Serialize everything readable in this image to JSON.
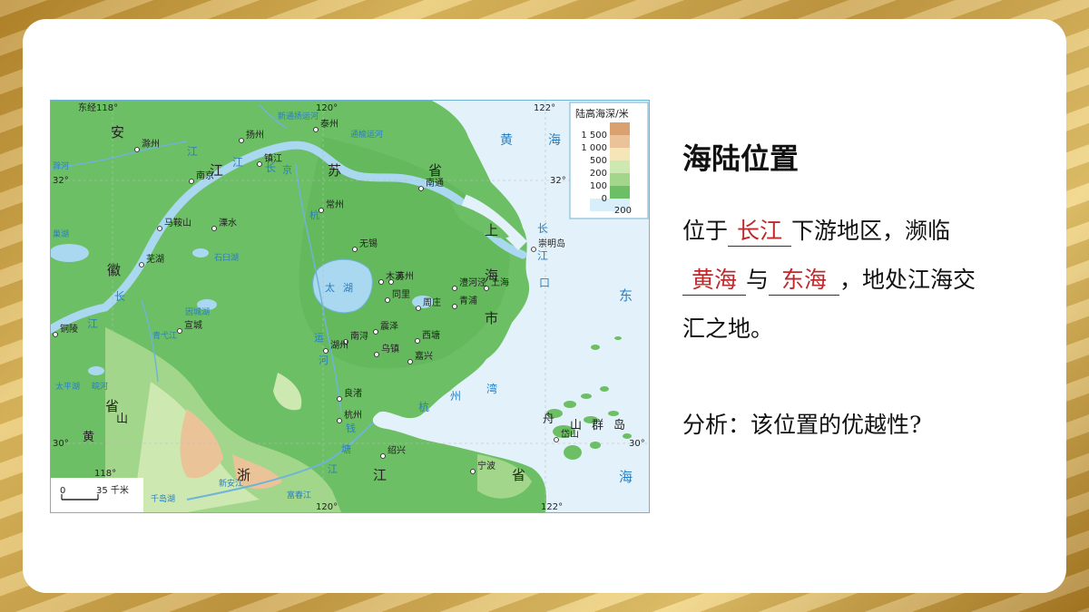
{
  "map": {
    "legend_title": "陆高海深/米",
    "legend_values": [
      "1 500",
      "1 000",
      "500",
      "200",
      "100",
      "0",
      "200"
    ],
    "legend_colors": [
      "#d9a070",
      "#ebc398",
      "#f5e6b8",
      "#cde8b0",
      "#a2d68a",
      "#6cbf64",
      "#d8eefa"
    ],
    "scale": {
      "zero": "0",
      "label": "35 千米"
    },
    "coords": [
      "东经118°",
      "120°",
      "122°",
      "32°",
      "32°",
      "30°",
      "30°",
      "118°",
      "120°",
      "122°"
    ],
    "cities": [
      "扬州",
      "泰州",
      "滁州",
      "南京",
      "镇江",
      "南通",
      "常州",
      "马鞍山",
      "溧水",
      "无锡",
      "崇明岛",
      "芜湖",
      "木渎",
      "苏州",
      "澧河泾",
      "上海",
      "同里",
      "周庄",
      "青浦",
      "震泽",
      "铜陵",
      "宣城",
      "南浔",
      "西塘",
      "湖州",
      "乌镇",
      "嘉兴",
      "良渚",
      "杭州",
      "绍兴",
      "宁波",
      "岱山"
    ],
    "regions": [
      "安",
      "江",
      "苏",
      "省",
      "徽",
      "上",
      "海",
      "市",
      "浙",
      "江",
      "省",
      "黄",
      "山",
      "舟",
      "山",
      "群",
      "岛",
      "省"
    ],
    "waters": [
      "黄",
      "海",
      "东",
      "海",
      "长",
      "江",
      "口",
      "太",
      "湖",
      "杭",
      "州",
      "湾",
      "新通扬运河",
      "通榆运河",
      "江",
      "京",
      "杭",
      "运",
      "河",
      "滁河",
      "皖河",
      "巢湖",
      "固城湖",
      "石臼湖",
      "长",
      "江",
      "青弋江",
      "新安江",
      "富春江",
      "千岛湖",
      "太平湖",
      "钱",
      "塘",
      "江",
      "长",
      "江"
    ]
  },
  "panel": {
    "title": "海陆位置",
    "line1_pre": "位于",
    "line1_answer": "长江",
    "line1_post": "下游地区，濒临",
    "line2_answer1": "黄海",
    "line2_mid": "与",
    "line2_answer2": "东海",
    "line2_post": "，地处江海交",
    "line3": "汇之地。",
    "question": "分析：该位置的优越性?"
  }
}
